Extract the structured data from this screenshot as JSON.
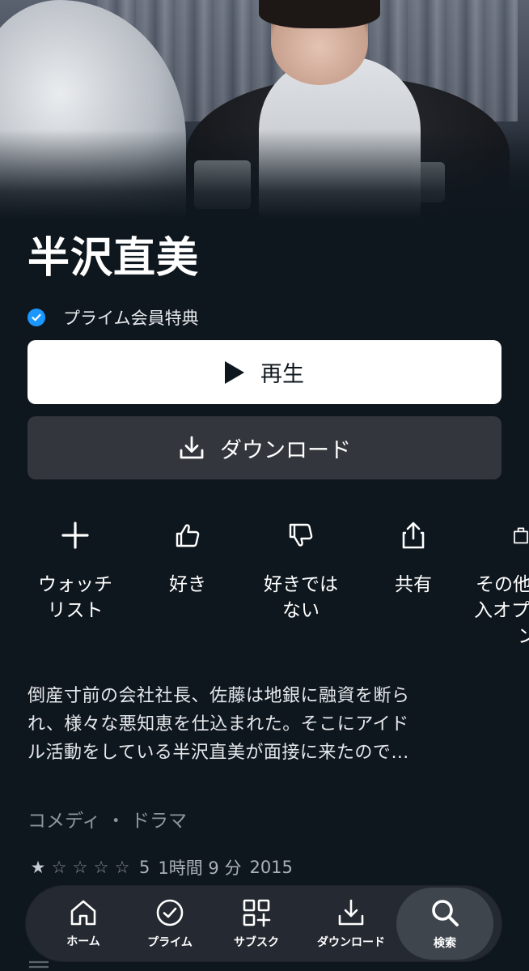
{
  "content": {
    "title": "半沢直美",
    "prime_label": "プライム会員特典",
    "play_label": "再生",
    "download_label": "ダウンロード",
    "actions": [
      {
        "icon": "plus-icon",
        "label_lines": [
          "ウォッチ",
          "リスト"
        ]
      },
      {
        "icon": "thumbs-up-icon",
        "label_lines": [
          "好き"
        ]
      },
      {
        "icon": "thumbs-down-icon",
        "label_lines": [
          "好きでは",
          "ない"
        ]
      },
      {
        "icon": "share-icon",
        "label_lines": [
          "共有"
        ]
      },
      {
        "icon": "more-options-icon",
        "label_lines": [
          "その他",
          "入オプ",
          "ン"
        ]
      }
    ],
    "description_lines": [
      "倒産寸前の会社社長、佐藤は地銀に融資を断ら",
      "れ、様々な悪知恵を仕込まれた。そこにアイド",
      "ル活動をしている半沢直美が面接に来たので…"
    ],
    "genres": "コメディ ・ ドラマ",
    "rating": {
      "stars": 1,
      "max": 5,
      "count": "5"
    },
    "duration": "1時間 9 分",
    "year": "2015"
  },
  "nav": {
    "items": [
      {
        "icon": "home-icon",
        "label": "ホーム"
      },
      {
        "icon": "prime-check-icon",
        "label": "プライム"
      },
      {
        "icon": "subscription-icon",
        "label": "サブスク"
      },
      {
        "icon": "download-icon",
        "label": "ダウンロード"
      },
      {
        "icon": "search-icon",
        "label": "検索",
        "active": true
      }
    ]
  },
  "colors": {
    "background": "#0f171e",
    "prime_blue": "#1a98ff",
    "download_button": "#33373d"
  }
}
